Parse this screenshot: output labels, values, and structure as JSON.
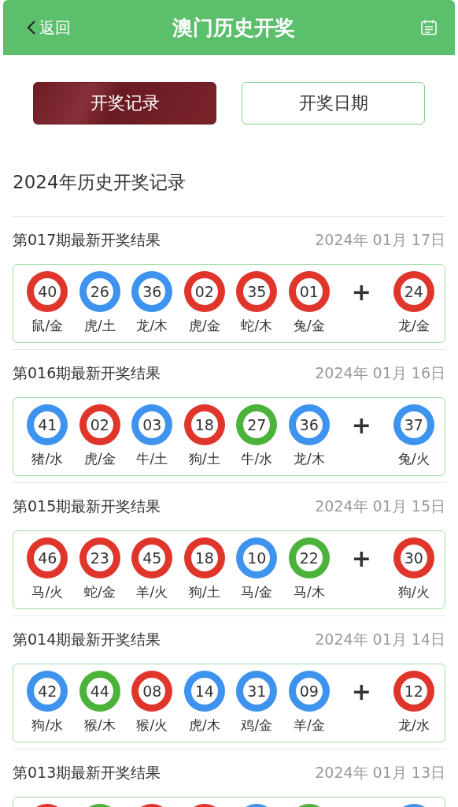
{
  "header": {
    "back": "返回",
    "title": "澳门历史开奖"
  },
  "tabs": [
    {
      "label": "开奖记录",
      "selected": true
    },
    {
      "label": "开奖日期",
      "selected": false
    }
  ],
  "section_title": "2024年历史开奖记录",
  "draws": [
    {
      "title": "第017期最新开奖结果",
      "date": "2024年 01月 17日",
      "plus": "+",
      "balls": [
        {
          "number": "40",
          "zodiac": "鼠/金",
          "color": "#e0352b"
        },
        {
          "number": "26",
          "zodiac": "虎/土",
          "color": "#3d93ee"
        },
        {
          "number": "36",
          "zodiac": "龙/木",
          "color": "#3d93ee"
        },
        {
          "number": "02",
          "zodiac": "虎/金",
          "color": "#e0352b"
        },
        {
          "number": "35",
          "zodiac": "蛇/木",
          "color": "#e0352b"
        },
        {
          "number": "01",
          "zodiac": "兔/金",
          "color": "#e0352b"
        }
      ],
      "special": {
        "number": "24",
        "zodiac": "龙/金",
        "color": "#e0352b"
      }
    },
    {
      "title": "第016期最新开奖结果",
      "date": "2024年 01月 16日",
      "plus": "+",
      "balls": [
        {
          "number": "41",
          "zodiac": "猪/水",
          "color": "#3d93ee"
        },
        {
          "number": "02",
          "zodiac": "虎/金",
          "color": "#e0352b"
        },
        {
          "number": "03",
          "zodiac": "牛/土",
          "color": "#3d93ee"
        },
        {
          "number": "18",
          "zodiac": "狗/土",
          "color": "#e0352b"
        },
        {
          "number": "27",
          "zodiac": "牛/水",
          "color": "#4cb33a"
        },
        {
          "number": "36",
          "zodiac": "龙/木",
          "color": "#3d93ee"
        }
      ],
      "special": {
        "number": "37",
        "zodiac": "兔/火",
        "color": "#3d93ee"
      }
    },
    {
      "title": "第015期最新开奖结果",
      "date": "2024年 01月 15日",
      "plus": "+",
      "balls": [
        {
          "number": "46",
          "zodiac": "马/火",
          "color": "#e0352b"
        },
        {
          "number": "23",
          "zodiac": "蛇/金",
          "color": "#e0352b"
        },
        {
          "number": "45",
          "zodiac": "羊/火",
          "color": "#e0352b"
        },
        {
          "number": "18",
          "zodiac": "狗/土",
          "color": "#e0352b"
        },
        {
          "number": "10",
          "zodiac": "马/金",
          "color": "#3d93ee"
        },
        {
          "number": "22",
          "zodiac": "马/木",
          "color": "#4cb33a"
        }
      ],
      "special": {
        "number": "30",
        "zodiac": "狗/火",
        "color": "#e0352b"
      }
    },
    {
      "title": "第014期最新开奖结果",
      "date": "2024年 01月 14日",
      "plus": "+",
      "balls": [
        {
          "number": "42",
          "zodiac": "狗/水",
          "color": "#3d93ee"
        },
        {
          "number": "44",
          "zodiac": "猴/木",
          "color": "#4cb33a"
        },
        {
          "number": "08",
          "zodiac": "猴/火",
          "color": "#e0352b"
        },
        {
          "number": "14",
          "zodiac": "虎/木",
          "color": "#3d93ee"
        },
        {
          "number": "31",
          "zodiac": "鸡/金",
          "color": "#3d93ee"
        },
        {
          "number": "09",
          "zodiac": "羊/金",
          "color": "#3d93ee"
        }
      ],
      "special": {
        "number": "12",
        "zodiac": "龙/水",
        "color": "#e0352b"
      }
    },
    {
      "title": "第013期最新开奖结果",
      "date": "2024年 01月 13日",
      "balls": [
        {
          "color": "#e0352b"
        },
        {
          "color": "#4cb33a"
        },
        {
          "color": "#e0352b"
        },
        {
          "color": "#e0352b"
        },
        {
          "color": "#3d93ee"
        },
        {
          "color": "#4cb33a"
        }
      ],
      "special": {
        "color": "#3d93ee"
      }
    }
  ]
}
